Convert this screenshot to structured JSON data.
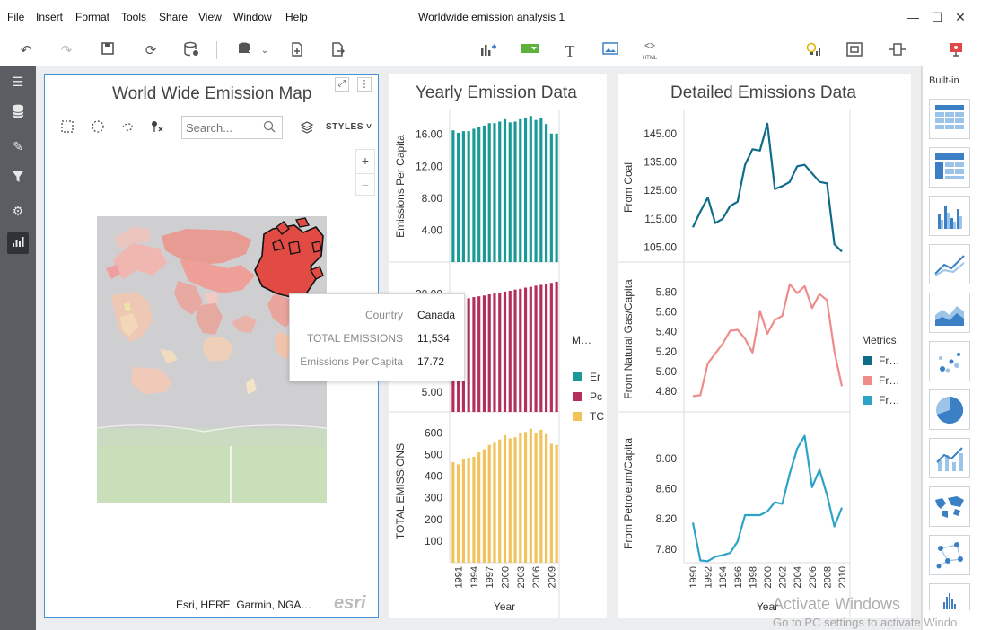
{
  "menubar": {
    "items": [
      "File",
      "Insert",
      "Format",
      "Tools",
      "Share",
      "View",
      "Window",
      "Help"
    ],
    "title": "Worldwide emission analysis 1"
  },
  "toolbar": {
    "html_label": "HTML"
  },
  "map": {
    "title": "World Wide Emission Map",
    "search_placeholder": "Search...",
    "styles_label": "STYLES",
    "zoom_in": "+",
    "zoom_out": "−",
    "attribution": "Esri, HERE, Garmin, NGA…",
    "logo": "esri",
    "tooltip": {
      "rows": [
        {
          "label": "Country",
          "value": "Canada"
        },
        {
          "label": "TOTAL EMISSIONS",
          "value": "11,534"
        },
        {
          "label": "Emissions Per Capita",
          "value": "17.72"
        }
      ]
    }
  },
  "yearly": {
    "title": "Yearly Emission Data",
    "legend_title": "M…",
    "legend": [
      {
        "label": "Er",
        "color": "#1a9a96"
      },
      {
        "label": "Pc",
        "color": "#b4305a"
      },
      {
        "label": "TC",
        "color": "#f2c25b"
      }
    ],
    "xlabel": "Year"
  },
  "detailed": {
    "title": "Detailed Emissions Data",
    "legend_title": "Metrics",
    "legend": [
      {
        "label": "Fr…",
        "color": "#0e6b8a"
      },
      {
        "label": "Fr…",
        "color": "#ee8c8c"
      },
      {
        "label": "Fr…",
        "color": "#2ea3c8"
      }
    ],
    "xlabel": "Year"
  },
  "right_panel": {
    "title": "Built-in"
  },
  "watermark": {
    "line1": "Activate Windows",
    "line2": "Go to PC settings to activate Windo"
  },
  "chart_data": [
    {
      "type": "bar",
      "panel": "Yearly Emission Data - top",
      "ylabel": "Emissions Per Capita",
      "color": "#1a9a96",
      "categories": [
        "1990",
        "1991",
        "1992",
        "1993",
        "1994",
        "1995",
        "1996",
        "1997",
        "1998",
        "1999",
        "2000",
        "2001",
        "2002",
        "2003",
        "2004",
        "2005",
        "2006",
        "2007",
        "2008",
        "2009",
        "2010"
      ],
      "values": [
        16.5,
        16.2,
        16.4,
        16.4,
        16.7,
        16.9,
        17.1,
        17.4,
        17.4,
        17.6,
        17.9,
        17.5,
        17.6,
        17.9,
        18.0,
        18.3,
        17.8,
        18.1,
        17.3,
        16.1,
        16.1
      ],
      "yticks": [
        "4.00",
        "8.00",
        "12.00",
        "16.00"
      ],
      "ylim": [
        0,
        19
      ]
    },
    {
      "type": "bar",
      "panel": "Yearly Emission Data - middle",
      "ylabel": "",
      "color": "#b4305a",
      "categories": [
        "1990",
        "1991",
        "1992",
        "1993",
        "1994",
        "1995",
        "1996",
        "1997",
        "1998",
        "1999",
        "2000",
        "2001",
        "2002",
        "2003",
        "2004",
        "2005",
        "2006",
        "2007",
        "2008",
        "2009",
        "2010"
      ],
      "values": [
        27.9,
        28.3,
        28.6,
        28.9,
        29.2,
        29.4,
        29.6,
        29.9,
        30.1,
        30.3,
        30.6,
        30.8,
        31.1,
        31.3,
        31.6,
        31.8,
        32.1,
        32.3,
        32.6,
        32.8,
        33.1
      ],
      "yticks": [
        "5.00",
        "30.00"
      ],
      "ylim": [
        0,
        34
      ]
    },
    {
      "type": "bar",
      "panel": "Yearly Emission Data - bottom",
      "ylabel": "TOTAL EMISSIONS",
      "xlabel": "Year",
      "color": "#f2c25b",
      "categories": [
        "1990",
        "1991",
        "1992",
        "1993",
        "1994",
        "1995",
        "1996",
        "1997",
        "1998",
        "1999",
        "2000",
        "2001",
        "2002",
        "2003",
        "2004",
        "2005",
        "2006",
        "2007",
        "2008",
        "2009",
        "2010"
      ],
      "xticks": [
        "1991",
        "1994",
        "1997",
        "2000",
        "2003",
        "2006",
        "2009"
      ],
      "values": [
        465,
        455,
        480,
        485,
        490,
        510,
        525,
        545,
        555,
        570,
        590,
        575,
        580,
        600,
        605,
        620,
        600,
        615,
        595,
        550,
        545
      ],
      "yticks": [
        "100",
        "200",
        "300",
        "400",
        "500",
        "600"
      ],
      "ylim": [
        0,
        660
      ]
    },
    {
      "type": "line",
      "panel": "Detailed Emissions Data - top",
      "ylabel": "From Coal",
      "color": "#0e6b8a",
      "x": [
        1990,
        1991,
        1992,
        1993,
        1994,
        1995,
        1996,
        1997,
        1998,
        1999,
        2000,
        2001,
        2002,
        2003,
        2004,
        2005,
        2006,
        2007,
        2008,
        2009,
        2010
      ],
      "y": [
        112,
        117.5,
        122.5,
        113.5,
        115,
        119.5,
        121,
        134,
        139.5,
        139,
        148.5,
        125.5,
        126.5,
        128,
        133.5,
        134,
        131,
        128,
        127.5,
        106,
        103.5
      ],
      "yticks": [
        "105.00",
        "115.00",
        "125.00",
        "135.00",
        "145.00"
      ],
      "ylim": [
        102,
        150
      ]
    },
    {
      "type": "line",
      "panel": "Detailed Emissions Data - middle",
      "ylabel": "From Natural Gas/Capita",
      "color": "#ee8c8c",
      "x": [
        1990,
        1991,
        1992,
        1993,
        1994,
        1995,
        1996,
        1997,
        1998,
        1999,
        2000,
        2001,
        2002,
        2003,
        2004,
        2005,
        2006,
        2007,
        2008,
        2009,
        2010
      ],
      "y": [
        4.75,
        4.76,
        5.08,
        5.18,
        5.28,
        5.41,
        5.42,
        5.33,
        5.19,
        5.61,
        5.38,
        5.52,
        5.56,
        5.88,
        5.79,
        5.86,
        5.64,
        5.78,
        5.72,
        5.2,
        4.85
      ],
      "yticks": [
        "4.80",
        "5.00",
        "5.20",
        "5.40",
        "5.60",
        "5.80"
      ],
      "ylim": [
        4.7,
        5.95
      ]
    },
    {
      "type": "line",
      "panel": "Detailed Emissions Data - bottom",
      "ylabel": "From Petroleum/Capita",
      "xlabel": "Year",
      "color": "#2ea3c8",
      "x": [
        1990,
        1991,
        1992,
        1993,
        1994,
        1995,
        1996,
        1997,
        1998,
        1999,
        2000,
        2001,
        2002,
        2003,
        2004,
        2005,
        2006,
        2007,
        2008,
        2009,
        2010
      ],
      "xticks": [
        "1990",
        "1992",
        "1994",
        "1996",
        "1998",
        "2000",
        "2002",
        "2004",
        "2006",
        "2008",
        "2010"
      ],
      "y": [
        8.15,
        7.65,
        7.64,
        7.7,
        7.72,
        7.75,
        7.9,
        8.25,
        8.25,
        8.25,
        8.3,
        8.42,
        8.4,
        8.8,
        9.13,
        9.3,
        8.62,
        8.85,
        8.52,
        8.1,
        8.35
      ],
      "yticks": [
        "7.80",
        "8.20",
        "8.60",
        "9.00"
      ],
      "ylim": [
        7.62,
        9.45
      ]
    }
  ]
}
